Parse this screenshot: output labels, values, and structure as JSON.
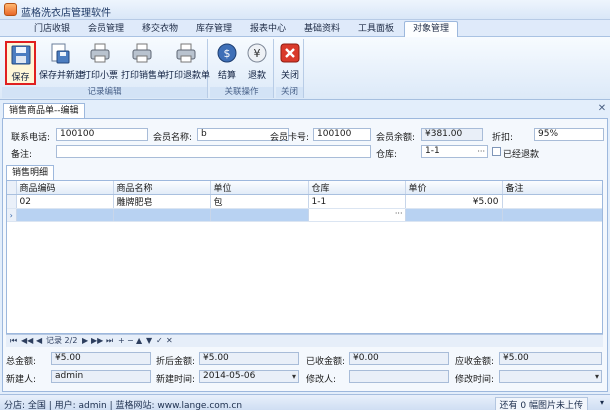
{
  "app": {
    "title": "蓝格洗衣店管理软件"
  },
  "ribbon_tabs": [
    "门店收银",
    "会员管理",
    "移交衣物",
    "库存管理",
    "报表中心",
    "基础资料",
    "工具面板",
    "对象管理"
  ],
  "ribbon": {
    "groups": [
      "记录编辑",
      "关联操作",
      "关闭"
    ],
    "buttons": [
      "保存",
      "保存并新建",
      "打印小票",
      "打印销售单",
      "打印退款单",
      "结算",
      "退款",
      "关闭"
    ]
  },
  "doc_tab": "销售商品单--编辑",
  "form": {
    "phone_label": "联系电话:",
    "phone_value": "100100",
    "member_name_label": "会员名称:",
    "member_name_value": "b",
    "card_label": "会员卡号:",
    "card_value": "100100",
    "balance_label": "会员余额:",
    "balance_value": "¥381.00",
    "discount_label": "折扣:",
    "discount_value": "95%",
    "note_label": "备注:",
    "note_value": "",
    "warehouse_label": "仓库:",
    "warehouse_value": "1-1",
    "refunded_label": "已经退款"
  },
  "subtab": "销售明细",
  "grid": {
    "columns": [
      "商品编码",
      "商品名称",
      "单位",
      "仓库",
      "单价",
      "备注"
    ],
    "rows": [
      {
        "code": "02",
        "name": "雕牌肥皂",
        "unit": "包",
        "warehouse": "1-1",
        "price": "¥5.00",
        "note": ""
      }
    ]
  },
  "navigator": {
    "record": "记录 2/2"
  },
  "footer": {
    "total_label": "总金额:",
    "total_value": "¥5.00",
    "after_discount_label": "折后金额:",
    "after_discount_value": "¥5.00",
    "received_label": "已收金额:",
    "received_value": "¥0.00",
    "receivable_label": "应收金额:",
    "receivable_value": "¥5.00",
    "creator_label": "新建人:",
    "creator_value": "admin",
    "created_time_label": "新建时间:",
    "created_time_value": "2014-05-06",
    "modifier_label": "修改人:",
    "modifier_value": "",
    "modified_time_label": "修改时间:",
    "modified_time_value": ""
  },
  "status": {
    "text": "分店: 全国 | 用户: admin | 蓝格网站: www.lange.com.cn",
    "right": "还有 0 幅图片未上传"
  },
  "colors": {
    "accent": "#3d6fb5",
    "selected_border": "#e02020"
  }
}
